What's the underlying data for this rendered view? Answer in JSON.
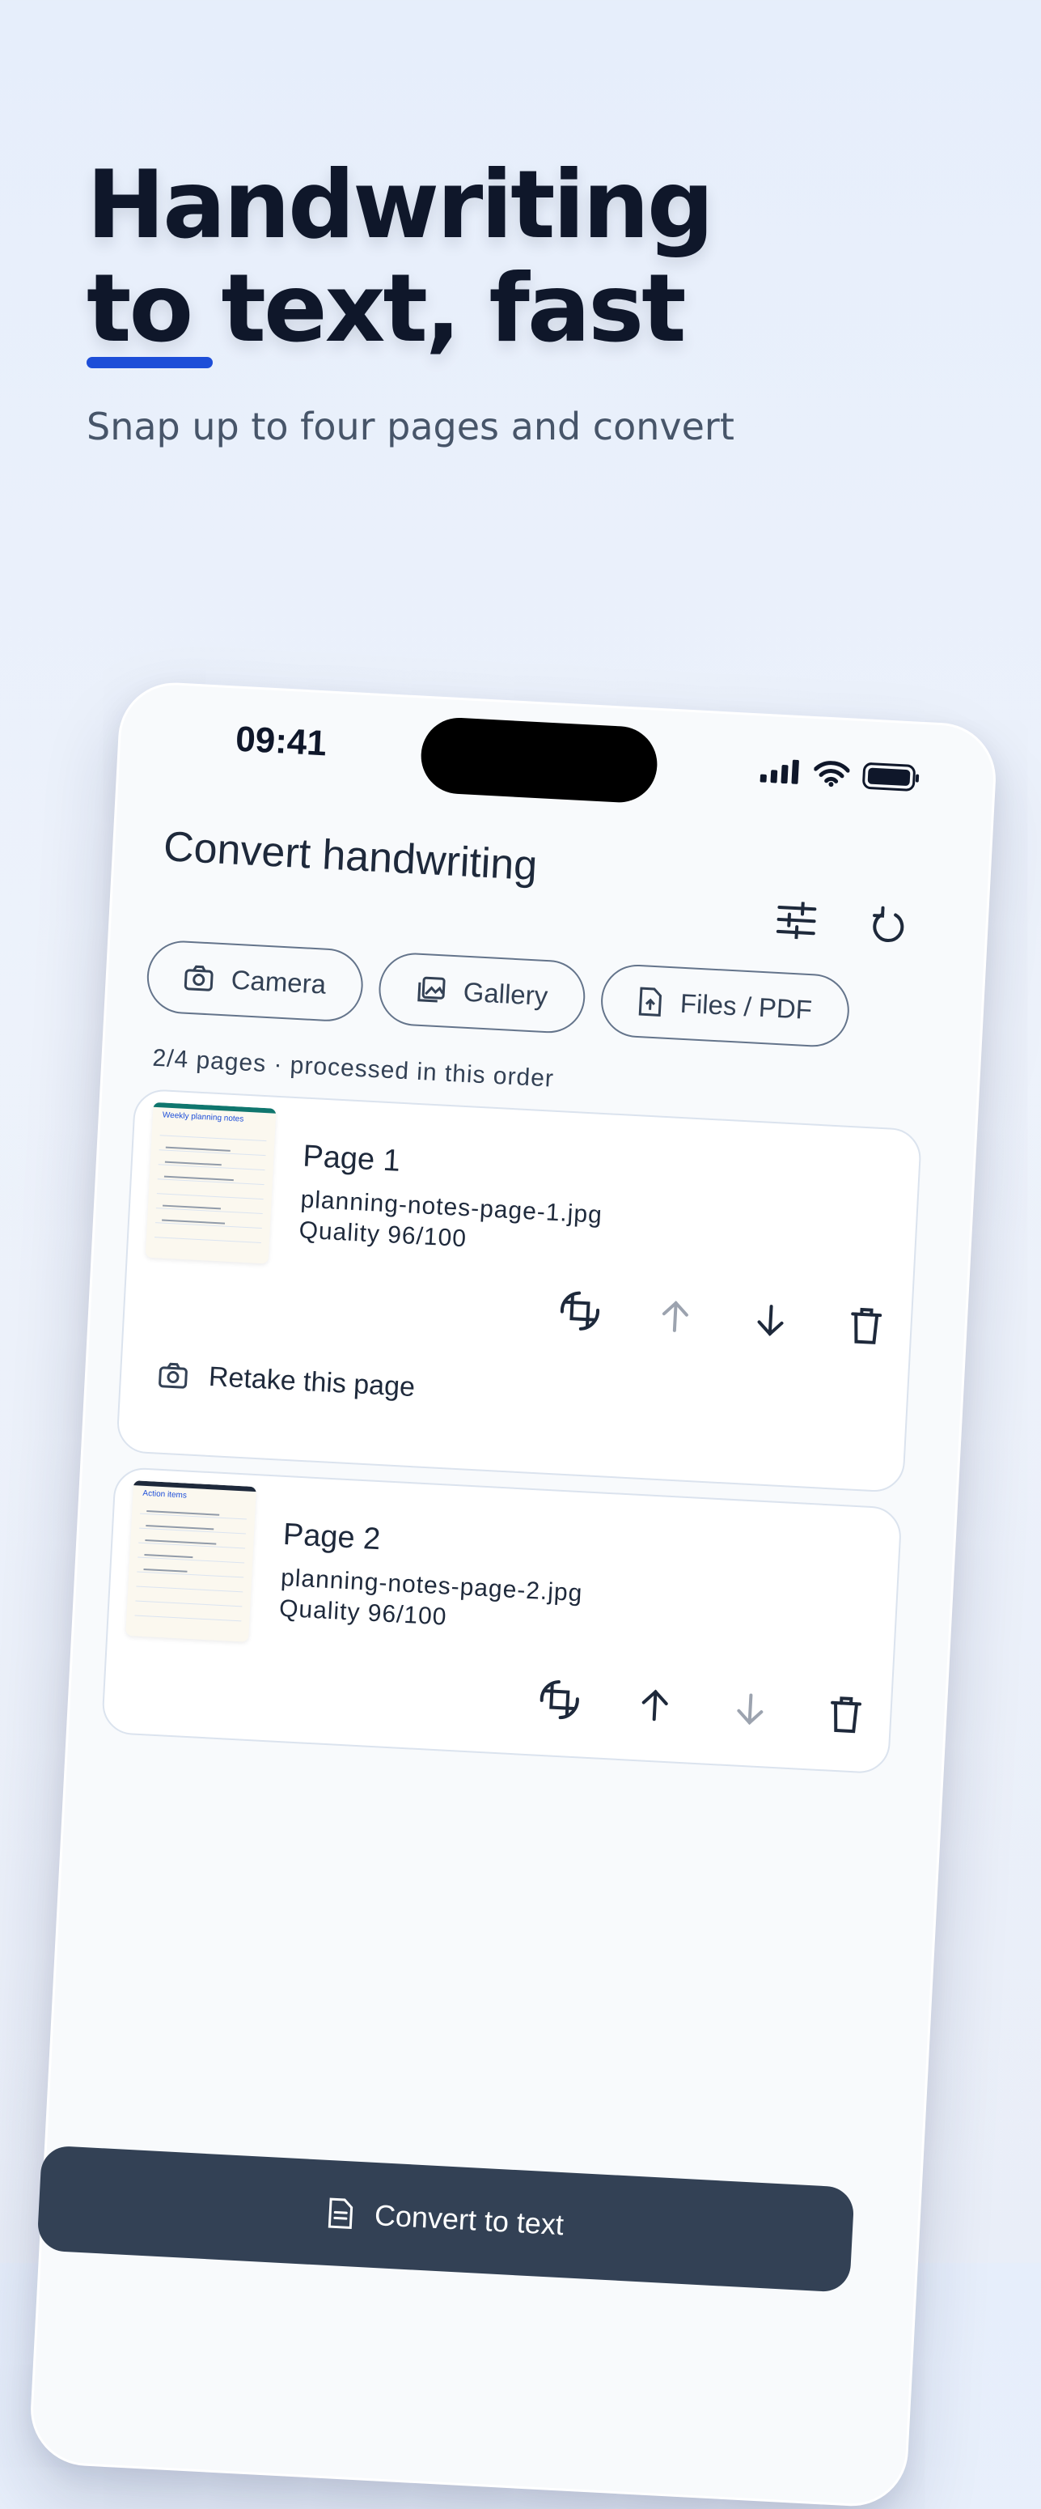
{
  "hero": {
    "headline_line1": "Handwriting",
    "headline_line2": "to text, fast",
    "subtitle": "Snap up to four pages and convert",
    "accent_color": "#1d4ed8"
  },
  "status_bar": {
    "time": "09:41",
    "icons": [
      "signal-icon",
      "wifi-icon",
      "battery-icon"
    ]
  },
  "app": {
    "title": "Convert handwriting",
    "top_actions": [
      "settings-sliders-icon",
      "reset-icon"
    ]
  },
  "sources": [
    {
      "label": "Camera",
      "icon": "camera-icon"
    },
    {
      "label": "Gallery",
      "icon": "gallery-icon"
    },
    {
      "label": "Files / PDF",
      "icon": "file-upload-icon"
    }
  ],
  "pages_meta": "2/4 pages · processed in this order",
  "pages": [
    {
      "title": "Page 1",
      "file": "planning-notes-page-1.jpg",
      "quality": "Quality 96/100",
      "thumbnail_title": "Weekly planning notes",
      "move_up_enabled": false,
      "move_down_enabled": true,
      "retake_label": "Retake this page"
    },
    {
      "title": "Page 2",
      "file": "planning-notes-page-2.jpg",
      "quality": "Quality 96/100",
      "thumbnail_title": "Action items",
      "move_up_enabled": true,
      "move_down_enabled": false
    }
  ],
  "convert_button": {
    "label": "Convert to text",
    "icon": "document-icon"
  },
  "colors": {
    "primary_dark": "#334155",
    "text": "#1e293b",
    "disabled_icon": "#9ca3af"
  }
}
